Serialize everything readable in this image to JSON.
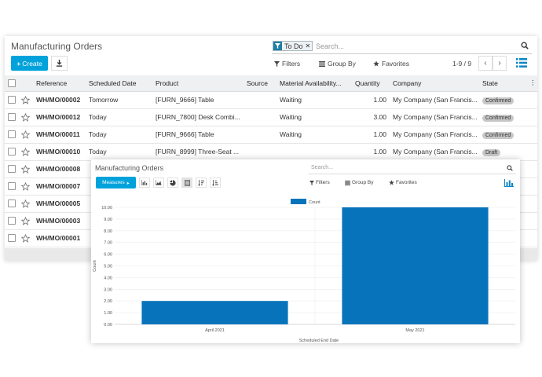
{
  "list_window": {
    "title": "Manufacturing Orders",
    "search": {
      "facet_label": "To Do",
      "placeholder": "Search..."
    },
    "create_label": "Create",
    "toolbar": {
      "filters": "Filters",
      "group_by": "Group By",
      "favorites": "Favorites"
    },
    "pager": "1-9 / 9",
    "columns": [
      "Reference",
      "Scheduled Date",
      "Product",
      "Source",
      "Material Availability",
      "Quantity",
      "Company",
      "State"
    ],
    "rows": [
      {
        "ref": "WH/MO/00002",
        "date": "Tomorrow",
        "product": "[FURN_9666] Table",
        "availability": "Waiting",
        "qty": "1.00",
        "company": "My Company (San Francis...",
        "state": "Confirmed"
      },
      {
        "ref": "WH/MO/00012",
        "date": "Today",
        "product": "[FURN_7800] Desk Combi...",
        "availability": "Waiting",
        "qty": "3.00",
        "company": "My Company (San Francis...",
        "state": "Confirmed"
      },
      {
        "ref": "WH/MO/00011",
        "date": "Today",
        "product": "[FURN_9666] Table",
        "availability": "Waiting",
        "qty": "1.00",
        "company": "My Company (San Francis...",
        "state": "Confirmed"
      },
      {
        "ref": "WH/MO/00010",
        "date": "Today",
        "product": "[FURN_8999] Three-Seat ...",
        "availability": "",
        "qty": "1.00",
        "company": "My Company (San Francis...",
        "state": "Draft"
      },
      {
        "ref": "WH/MO/00008"
      },
      {
        "ref": "WH/MO/00007"
      },
      {
        "ref": "WH/MO/00005"
      },
      {
        "ref": "WH/MO/00003"
      },
      {
        "ref": "WH/MO/00001"
      }
    ]
  },
  "graph_window": {
    "title": "Manufacturing Orders",
    "search_placeholder": "Search...",
    "measures_label": "Measures",
    "toolbar": {
      "filters": "Filters",
      "group_by": "Group By",
      "favorites": "Favorites"
    }
  },
  "colors": {
    "accent": "#00a2db",
    "bar": "#0773bb",
    "today": "#f0a400"
  },
  "chart_data": {
    "type": "bar",
    "categories": [
      "April 2021",
      "May 2021"
    ],
    "series": [
      {
        "name": "Count",
        "values": [
          2,
          10
        ]
      }
    ],
    "xlabel": "Scheduled End Date",
    "ylabel": "Count",
    "ylim": [
      0,
      10
    ],
    "yticks": [
      "0.00",
      "1.00",
      "2.00",
      "3.00",
      "4.00",
      "5.00",
      "6.00",
      "7.00",
      "8.00",
      "9.00",
      "10.00"
    ],
    "legend_position": "top",
    "grid": true
  }
}
